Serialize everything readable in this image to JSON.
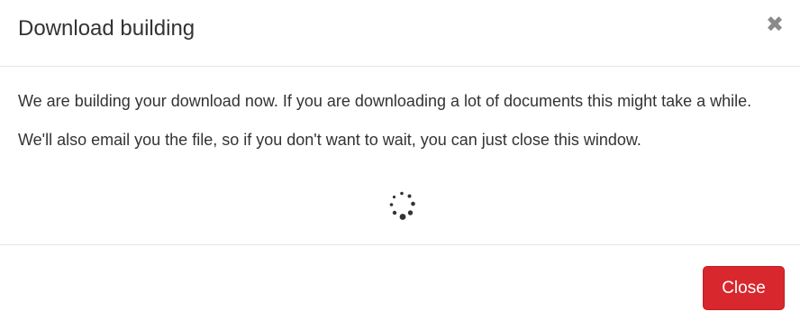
{
  "dialog": {
    "title": "Download building",
    "close_icon": "close-icon",
    "close_glyph": "✖",
    "body": {
      "paragraph1": "We are building your download now. If you are downloading a lot of documents this might take a while.",
      "paragraph2": "We'll also email you the file, so if you don't want to wait, you can just close this window.",
      "spinner_icon": "loading-spinner-icon"
    },
    "footer": {
      "close_label": "Close"
    }
  },
  "colors": {
    "primary_button": "#d9272e",
    "text": "#333333",
    "close_icon": "#8a8a8a",
    "divider": "#e5e5e5"
  }
}
